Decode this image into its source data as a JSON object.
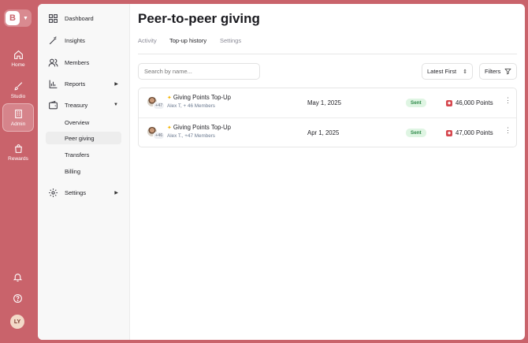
{
  "app": {
    "logo_text": "B",
    "rail": [
      {
        "label": "Home",
        "icon": "home-icon"
      },
      {
        "label": "Studio",
        "icon": "brush-icon"
      },
      {
        "label": "Admin",
        "icon": "building-icon",
        "active": true
      },
      {
        "label": "Rewards",
        "icon": "gift-icon"
      }
    ],
    "user_initials": "LY"
  },
  "sidebar": {
    "items": [
      {
        "label": "Dashboard",
        "icon": "dashboard-icon"
      },
      {
        "label": "Insights",
        "icon": "magic-wand-icon"
      },
      {
        "label": "Members",
        "icon": "users-icon"
      },
      {
        "label": "Reports",
        "icon": "bar-chart-icon",
        "arrow": "▶"
      },
      {
        "label": "Treasury",
        "icon": "wallet-icon",
        "arrow": "▼"
      },
      {
        "label": "Settings",
        "icon": "gear-icon",
        "arrow": "▶"
      }
    ],
    "treasury_sub": [
      {
        "label": "Overview"
      },
      {
        "label": "Peer giving",
        "active": true
      },
      {
        "label": "Transfers"
      },
      {
        "label": "Billing"
      }
    ]
  },
  "main": {
    "title": "Peer-to-peer giving",
    "tabs": [
      {
        "label": "Activity"
      },
      {
        "label": "Top-up history",
        "active": true
      },
      {
        "label": "Settings"
      }
    ],
    "search_placeholder": "Search by name...",
    "sort_label": "Latest First",
    "filter_label": "Filters",
    "rows": [
      {
        "count": "+47",
        "title": "Giving Points Top-Up",
        "subtitle": "Alex T, + 46 Members",
        "date": "May 1, 2025",
        "status": "Sent",
        "points": "46,000 Points"
      },
      {
        "count": "+46",
        "title": "Giving Points Top-Up",
        "subtitle": "Alex T., +47 Members",
        "date": "Apr 1, 2025",
        "status": "Sent",
        "points": "47,000 Points"
      }
    ]
  },
  "colors": {
    "brand": "#c9636b",
    "status_sent_bg": "#dff5e3",
    "status_sent_text": "#2f8a4a"
  }
}
